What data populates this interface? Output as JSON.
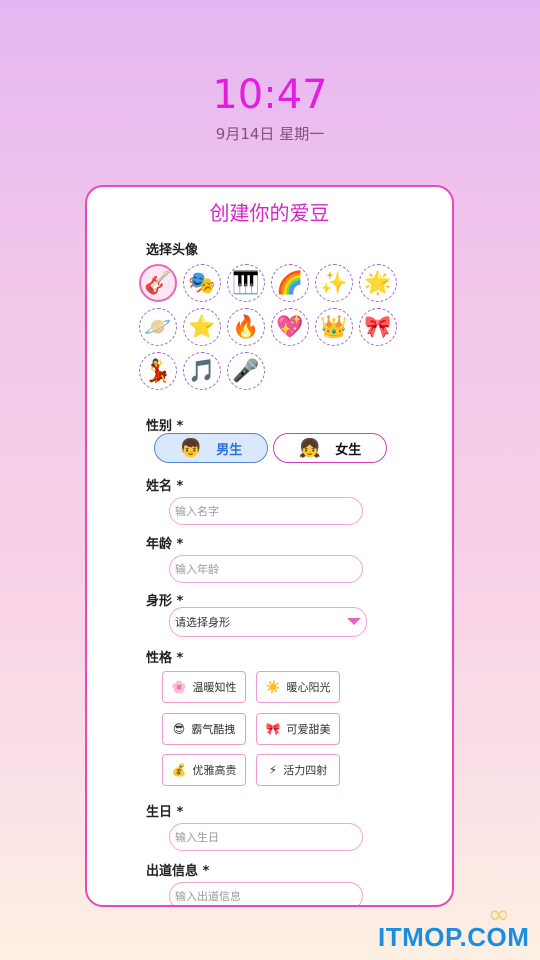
{
  "status": {
    "time": "10:47",
    "date": "9月14日 星期一"
  },
  "form": {
    "title": "创建你的爱豆",
    "avatar_label": "选择头像",
    "avatars": [
      {
        "emoji": "🎸",
        "name": "guitar"
      },
      {
        "emoji": "🎭",
        "name": "theater-masks"
      },
      {
        "emoji": "🎹",
        "name": "piano"
      },
      {
        "emoji": "🌈",
        "name": "rainbow"
      },
      {
        "emoji": "✨",
        "name": "sparkles"
      },
      {
        "emoji": "🌟",
        "name": "glowing-star"
      },
      {
        "emoji": "🪐",
        "name": "planet"
      },
      {
        "emoji": "⭐",
        "name": "star"
      },
      {
        "emoji": "🔥",
        "name": "fire"
      },
      {
        "emoji": "💖",
        "name": "sparkling-heart"
      },
      {
        "emoji": "👑",
        "name": "crown"
      },
      {
        "emoji": "🎀",
        "name": "ribbon"
      },
      {
        "emoji": "💃",
        "name": "dancer"
      },
      {
        "emoji": "🎵",
        "name": "music-note"
      },
      {
        "emoji": "🎤",
        "name": "microphone"
      }
    ],
    "selected_avatar": 0,
    "gender_label": "性别 *",
    "gender_male": "男生",
    "gender_female": "女生",
    "gender_male_icon": "👦",
    "gender_female_icon": "👧",
    "name_label": "姓名 *",
    "name_placeholder": "输入名字",
    "age_label": "年龄 *",
    "age_placeholder": "输入年龄",
    "body_label": "身形 *",
    "body_value": "请选择身形",
    "personality_label": "性格 *",
    "traits": [
      {
        "icon": "🌸",
        "label": "温暖知性"
      },
      {
        "icon": "☀️",
        "label": "暖心阳光"
      },
      {
        "icon": "😎",
        "label": "霸气酷拽"
      },
      {
        "icon": "🎀",
        "label": "可爱甜美"
      },
      {
        "icon": "💰",
        "label": "优雅高贵"
      },
      {
        "icon": "⚡",
        "label": "活力四射"
      }
    ],
    "birthday_label": "生日 *",
    "birthday_placeholder": "输入生日",
    "debut_label": "出道信息 *",
    "debut_placeholder": "输入出道信息"
  },
  "watermark": {
    "text": "ITMOP.COM"
  }
}
